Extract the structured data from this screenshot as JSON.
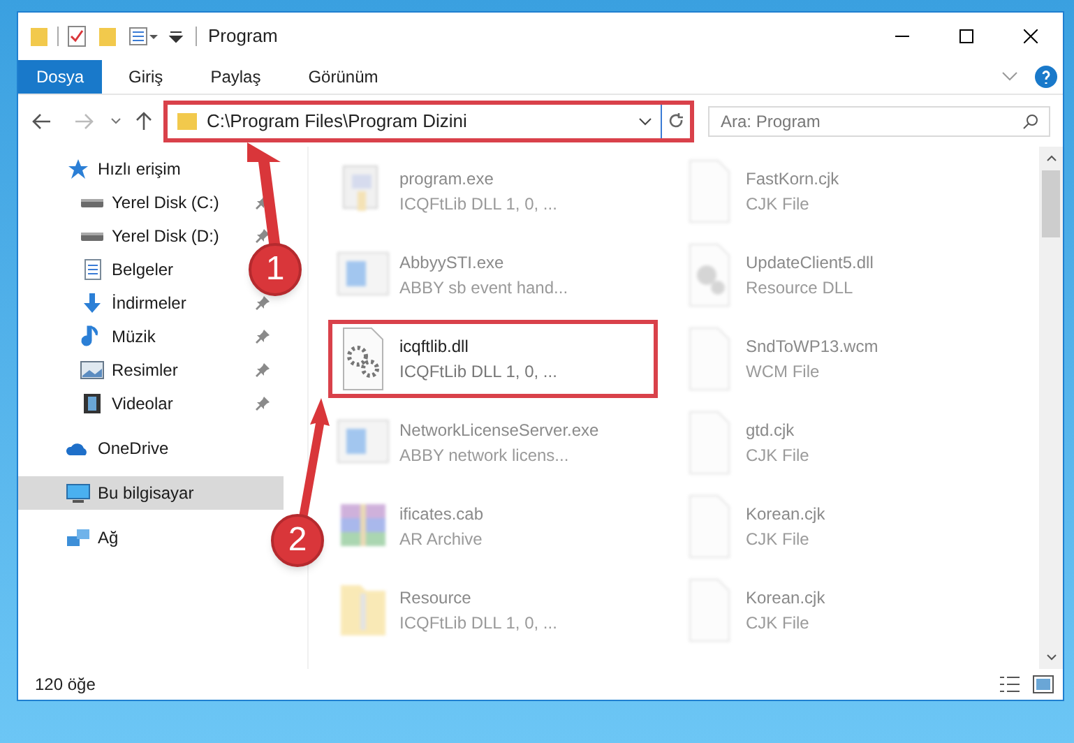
{
  "window": {
    "title": "Program"
  },
  "ribbon": {
    "tabs": [
      {
        "label": "Dosya",
        "selected": true
      },
      {
        "label": "Giriş",
        "selected": false
      },
      {
        "label": "Paylaş",
        "selected": false
      },
      {
        "label": "Görünüm",
        "selected": false
      }
    ]
  },
  "address_bar": {
    "path": "C:\\Program Files\\Program Dizini",
    "highlighted": true
  },
  "search": {
    "placeholder": "Ara: Program"
  },
  "sidebar": {
    "items": [
      {
        "label": "Hızlı erişim",
        "kind": "star",
        "selected": false,
        "children": [
          {
            "label": "Yerel Disk (C:)",
            "kind": "drive",
            "pinned": true,
            "selected": false
          },
          {
            "label": "Yerel Disk (D:)",
            "kind": "drive",
            "pinned": true,
            "selected": false
          },
          {
            "label": "Belgeler",
            "kind": "document",
            "pinned": false,
            "selected": false
          },
          {
            "label": "İndirmeler",
            "kind": "download",
            "pinned": true,
            "selected": false
          },
          {
            "label": "Müzik",
            "kind": "music",
            "pinned": true,
            "selected": false
          },
          {
            "label": "Resimler",
            "kind": "pictures",
            "pinned": true,
            "selected": false
          },
          {
            "label": "Videolar",
            "kind": "video",
            "pinned": true,
            "selected": false
          }
        ]
      },
      {
        "label": "OneDrive",
        "kind": "cloud",
        "selected": false
      },
      {
        "label": "Bu bilgisayar",
        "kind": "computer",
        "selected": true
      },
      {
        "label": "Ağ",
        "kind": "network",
        "selected": false
      }
    ]
  },
  "files": [
    {
      "name": "program.exe",
      "description": "ICQFtLib DLL 1, 0, ...",
      "kind": "installer",
      "highlighted": false
    },
    {
      "name": "FastKorn.cjk",
      "description": "CJK File",
      "kind": "blank",
      "highlighted": false
    },
    {
      "name": "AbbyySTI.exe",
      "description": "ABBY sb event hand...",
      "kind": "app",
      "highlighted": false
    },
    {
      "name": "UpdateClient5.dll",
      "description": "Resource DLL",
      "kind": "dll",
      "highlighted": false
    },
    {
      "name": "icqftlib.dll",
      "description": "ICQFtLib DLL 1, 0, ...",
      "kind": "gears",
      "highlighted": true
    },
    {
      "name": "SndToWP13.wcm",
      "description": "WCM File",
      "kind": "blank",
      "highlighted": false
    },
    {
      "name": "NetworkLicenseServer.exe",
      "description": "ABBY network licens...",
      "kind": "app",
      "highlighted": false
    },
    {
      "name": "gtd.cjk",
      "description": "CJK File",
      "kind": "blank",
      "highlighted": false
    },
    {
      "name": "ificates.cab",
      "description": "AR Archive",
      "kind": "archive",
      "highlighted": false
    },
    {
      "name": "Korean.cjk",
      "description": "CJK File",
      "kind": "blank",
      "highlighted": false
    },
    {
      "name": "Resource",
      "description": "ICQFtLib DLL 1, 0, ...",
      "kind": "folder",
      "highlighted": false
    },
    {
      "name": "Korean.cjk",
      "description": "CJK File",
      "kind": "blank",
      "highlighted": false
    }
  ],
  "callouts": [
    {
      "number": "1"
    },
    {
      "number": "2"
    }
  ],
  "status_bar": {
    "item_count": "120 öğe"
  }
}
